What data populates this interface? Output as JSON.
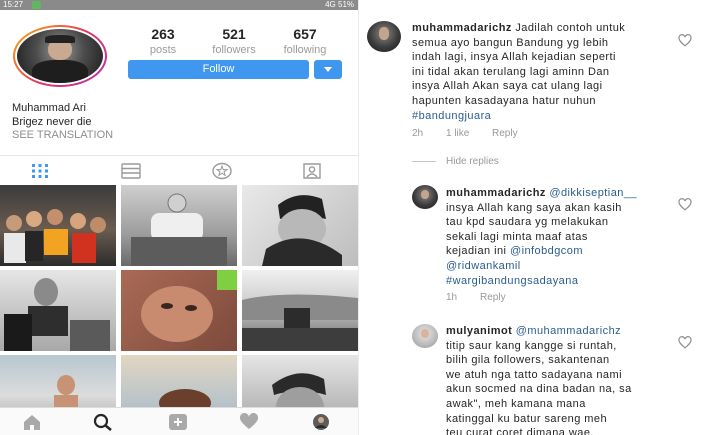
{
  "status_bar": {
    "time": "15:27",
    "right": "4G 51%"
  },
  "profile": {
    "stats": [
      {
        "value": "263",
        "label": "posts"
      },
      {
        "value": "521",
        "label": "followers"
      },
      {
        "value": "657",
        "label": "following"
      }
    ],
    "follow_label": "Follow",
    "dropdown_icon": "caret-down-icon",
    "name": "Muhammad Ari",
    "bio": "Brigez never die",
    "see_translation": "SEE TRANSLATION"
  },
  "tabs": [
    "grid-icon",
    "list-icon",
    "tagged-places-icon",
    "tagged-photos-icon"
  ],
  "bottom_nav": [
    "home-icon",
    "search-icon",
    "add-post-icon",
    "heart-icon",
    "profile-avatar-icon"
  ],
  "grid_photos": 9,
  "colors": {
    "accent": "#3f97f0",
    "link": "#2b5d8e",
    "meta": "#999999"
  },
  "comments": [
    {
      "user": "muhammadarichz",
      "lines": [
        "Jadilah contoh untuk",
        "semua ayo bangun Bandung yg lebih",
        "indah lagi, insya Allah kejadian seperti",
        "ini tidal akan terulang lagi aminn Dan",
        "insya Allah Akan saya cat ulang lagi",
        "hapunten kasadayana hatur nuhun"
      ],
      "hashtag": "#bandungjuara",
      "time": "2h",
      "likes": "1 like",
      "reply": "Reply",
      "hide_replies": "Hide replies"
    },
    {
      "user": "muhammadarichz",
      "mention": "@dikkiseptian__",
      "lines": [
        "insya Allah kang saya akan kasih",
        "tau kpd saudara yg melakukan",
        "sekali lagi minta maaf atas"
      ],
      "line4_prefix": "kejadian ini ",
      "links": [
        "@infobdgcom",
        "@ridwankamil",
        "#wargibandungsadayana"
      ],
      "time": "1h",
      "reply": "Reply"
    },
    {
      "user": "mulyanimot",
      "mention": "@muhammadarichz",
      "lines": [
        "titip saur kang kangge si runtah,",
        "bilih gila followers, sakantenan",
        "we atuh nga tatto sadayana nami",
        "akun socmed na dina badan na, sa",
        "awak\", meh kamana mana",
        "katinggal ku batur sareng meh",
        "teu curat coret dimana wae."
      ]
    }
  ]
}
